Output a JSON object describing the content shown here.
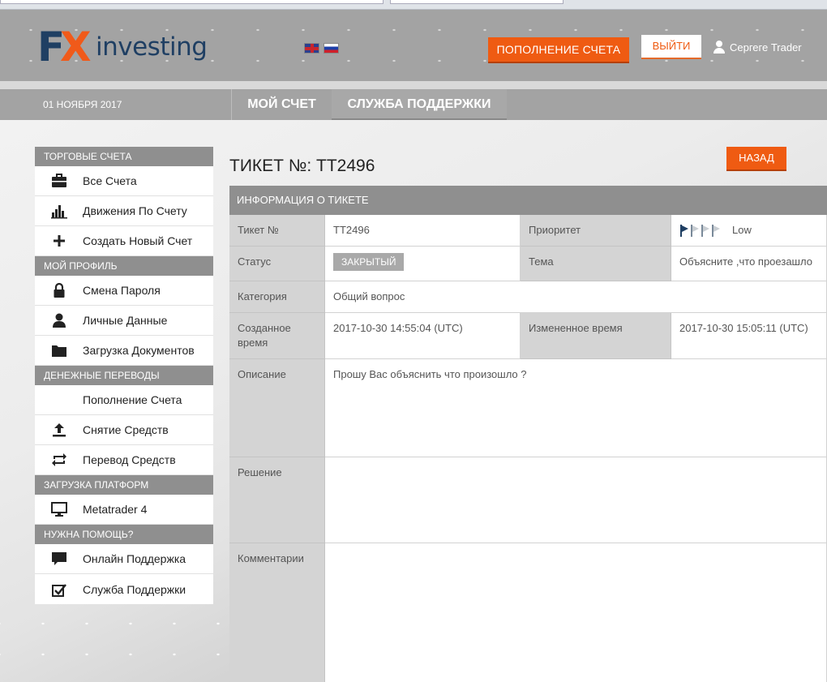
{
  "header": {
    "logo_fx": "F",
    "logo_x": "X",
    "logo_word": "investing",
    "deposit_button": "ПОПОЛНЕНИЕ СЧЕТА",
    "logout_button": "ВЫЙТИ",
    "user_name": "Сергеге Trader",
    "languages": [
      "en",
      "ru"
    ]
  },
  "nav": {
    "date": "01 НОЯБРЯ 2017",
    "tabs": [
      {
        "label": "МОЙ СЧЕТ"
      },
      {
        "label": "СЛУЖБА ПОДДЕРЖКИ"
      }
    ]
  },
  "sidebar": {
    "sections": [
      {
        "title": "ТОРГОВЫЕ СЧЕТА",
        "items": [
          {
            "label": "Все Счета",
            "icon": "briefcase-icon"
          },
          {
            "label": "Движения По Счету",
            "icon": "bar-chart-icon"
          },
          {
            "label": "Создать Новый Счет",
            "icon": "plus-icon"
          }
        ]
      },
      {
        "title": "МОЙ ПРОФИЛЬ",
        "items": [
          {
            "label": "Смена Пароля",
            "icon": "lock-icon"
          },
          {
            "label": "Личные Данные",
            "icon": "user-icon"
          },
          {
            "label": "Загрузка Документов",
            "icon": "folder-icon"
          }
        ]
      },
      {
        "title": "ДЕНЕЖНЫЕ ПЕРЕВОДЫ",
        "items": [
          {
            "label": "Пополнение Счета",
            "icon": ""
          },
          {
            "label": "Снятие Средств",
            "icon": "upload-icon"
          },
          {
            "label": "Перевод Средств",
            "icon": "transfer-icon"
          }
        ]
      },
      {
        "title": "ЗАГРУЗКА ПЛАТФОРМ",
        "items": [
          {
            "label": "Metatrader 4",
            "icon": "monitor-icon"
          }
        ]
      },
      {
        "title": "НУЖНА ПОМОЩЬ?",
        "items": [
          {
            "label": "Онлайн Поддержка",
            "icon": "chat-icon"
          },
          {
            "label": "Служба Поддержки",
            "icon": "checkbox-icon"
          }
        ]
      }
    ]
  },
  "ticket": {
    "title": "ТИКЕТ №: TT2496",
    "back_button": "НАЗАД",
    "info_header": "ИНФОРМАЦИЯ О ТИКЕТЕ",
    "labels": {
      "number": "Тикет №",
      "priority": "Приоритет",
      "status": "Статус",
      "subject": "Тема",
      "category": "Категория",
      "created": "Созданное время",
      "modified": "Измененное время",
      "description": "Описание",
      "resolution": "Решение",
      "comments": "Комментарии"
    },
    "values": {
      "number": "TT2496",
      "priority": "Low",
      "priority_level": 1,
      "priority_max": 4,
      "status": "ЗАКРЫТЫЙ",
      "subject": "Объясните ,что проезашло",
      "category": "Общий вопрос",
      "created": "2017-10-30 14:55:04 (UTC)",
      "modified": "2017-10-30 15:05:11 (UTC)",
      "description": "Прошу Вас объяснить что произошло ?",
      "resolution": "",
      "comments": ""
    }
  }
}
